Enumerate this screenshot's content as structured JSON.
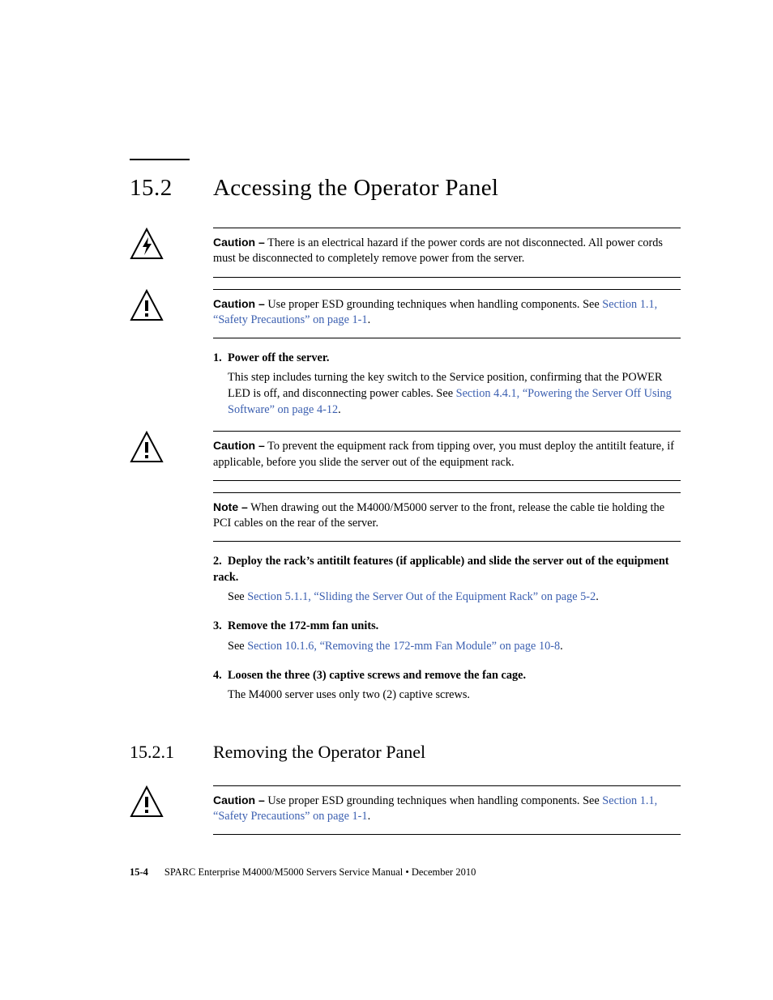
{
  "section": {
    "number": "15.2",
    "title": "Accessing the Operator Panel"
  },
  "caution1": {
    "label": "Caution –",
    "text": " There is an electrical hazard if the power cords are not disconnected. All power cords must be disconnected to completely remove power from the server."
  },
  "caution2": {
    "label": "Caution –",
    "text": " Use proper ESD grounding techniques when handling components. See ",
    "link": "Section 1.1, “Safety Precautions” on page 1-1",
    "after": "."
  },
  "step1": {
    "num": "1.",
    "head": "Power off the server.",
    "body_a": "This step includes turning the key switch to the Service position, confirming that the POWER LED is off, and disconnecting power cables. See ",
    "link": "Section 4.4.1, “Powering the Server Off Using Software” on page 4-12",
    "body_b": "."
  },
  "caution3": {
    "label": "Caution –",
    "text": " To prevent the equipment rack from tipping over, you must deploy the antitilt feature, if applicable, before you slide the server out of the equipment rack."
  },
  "note": {
    "label": "Note –",
    "text": " When drawing out the M4000/M5000 server to the front, release the cable tie holding the PCI cables on the rear of the server."
  },
  "step2": {
    "num": "2.",
    "head": "Deploy the rack’s antitilt features (if applicable) and slide the server out of the equipment rack.",
    "body_a": "See ",
    "link": "Section 5.1.1, “Sliding the Server Out of the Equipment Rack” on page 5-2",
    "body_b": "."
  },
  "step3": {
    "num": "3.",
    "head": "Remove the 172-mm fan units.",
    "body_a": "See ",
    "link": "Section 10.1.6, “Removing the 172-mm Fan Module” on page 10-8",
    "body_b": "."
  },
  "step4": {
    "num": "4.",
    "head": "Loosen the three (3) captive screws and remove the fan cage.",
    "body": "The M4000 server uses only two (2) captive screws."
  },
  "subsection": {
    "number": "15.2.1",
    "title": "Removing the Operator Panel"
  },
  "caution4": {
    "label": "Caution –",
    "text": " Use proper ESD grounding techniques when handling components. See ",
    "link": "Section 1.1, “Safety Precautions” on page 1-1",
    "after": "."
  },
  "footer": {
    "page": "15-4",
    "text": "SPARC Enterprise M4000/M5000 Servers Service Manual  •  December 2010"
  }
}
